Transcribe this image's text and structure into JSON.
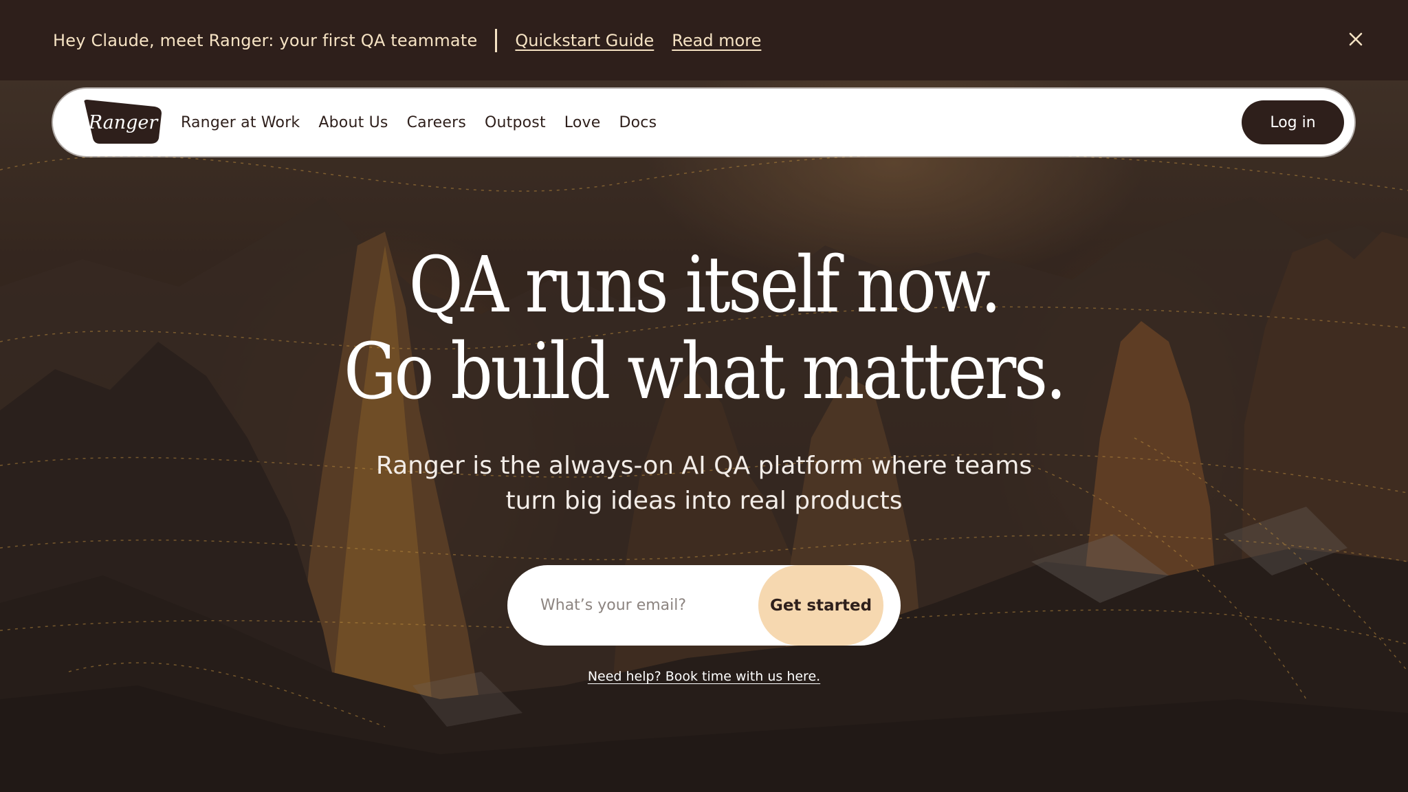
{
  "announcement": {
    "message": "Hey Claude, meet Ranger: your first QA teammate",
    "links": [
      "Quickstart Guide",
      "Read more"
    ]
  },
  "nav": {
    "logo_text": "Ranger",
    "links": [
      "Ranger at Work",
      "About Us",
      "Careers",
      "Outpost",
      "Love",
      "Docs"
    ],
    "login_label": "Log in"
  },
  "hero": {
    "headline_line1": "QA runs itself now.",
    "headline_line2": "Go build what matters.",
    "subtitle_line1": "Ranger is the always-on AI QA platform where teams",
    "subtitle_line2": "turn big ideas into real products",
    "email_placeholder": "What’s your email?",
    "cta_label": "Get started",
    "help_link": "Need help? Book time with us here."
  },
  "colors": {
    "dark_brown": "#2e1f1b",
    "cream": "#f6e3c4",
    "cta_peach": "#f6d8b0"
  },
  "icons": {
    "close": "close-icon",
    "logo": "ranger-logo"
  }
}
